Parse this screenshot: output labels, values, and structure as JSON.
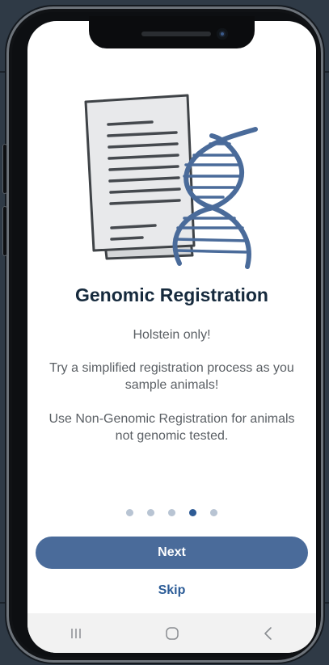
{
  "onboarding": {
    "title": "Genomic Registration",
    "subtitle": "Holstein only!",
    "description": "Try a simplified registration process as you sample animals!",
    "note": "Use Non-Genomic Registration for animals not genomic tested.",
    "page_indicator": {
      "total": 5,
      "active_index": 3
    },
    "next_label": "Next",
    "skip_label": "Skip"
  },
  "nav_bar": {
    "recent_icon": "recent-apps-icon",
    "home_icon": "home-icon",
    "back_icon": "back-icon"
  },
  "colors": {
    "primary_button": "#4a6b9a",
    "link": "#2c5c97",
    "title": "#162a3d",
    "dot_active": "#2e5b95",
    "dot_inactive": "#b8c4d3",
    "dna": "#4a6b9a"
  },
  "illustration": {
    "icon": "document-dna-icon"
  }
}
